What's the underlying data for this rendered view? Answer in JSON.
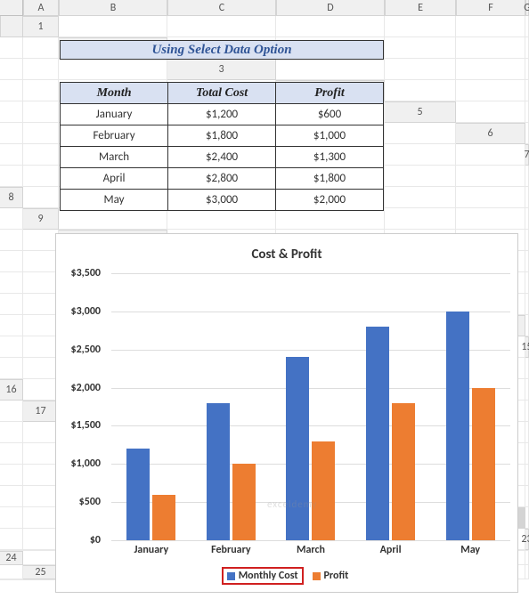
{
  "columns": [
    "A",
    "B",
    "C",
    "D",
    "E",
    "F",
    "G"
  ],
  "rowCount": 25,
  "activeRow": 22,
  "title": "Using Select Data Option",
  "table": {
    "headers": [
      "Month",
      "Total Cost",
      "Profit"
    ],
    "rows": [
      [
        "January",
        "$1,200",
        "$600"
      ],
      [
        "February",
        "$1,800",
        "$1,000"
      ],
      [
        "March",
        "$2,400",
        "$1,300"
      ],
      [
        "April",
        "$2,800",
        "$1,800"
      ],
      [
        "May",
        "$3,000",
        "$2,000"
      ]
    ]
  },
  "chart_data": {
    "type": "bar",
    "title": "Cost & Profit",
    "categories": [
      "January",
      "February",
      "March",
      "April",
      "May"
    ],
    "series": [
      {
        "name": "Monthly Cost",
        "values": [
          1200,
          1800,
          2400,
          2800,
          3000
        ],
        "color": "#4472c4",
        "highlighted": true
      },
      {
        "name": "Profit",
        "values": [
          600,
          1000,
          1300,
          1800,
          2000
        ],
        "color": "#ed7d31",
        "highlighted": false
      }
    ],
    "ylim": [
      0,
      3500
    ],
    "ystep": 500,
    "yticks": [
      "$0",
      "$500",
      "$1,000",
      "$1,500",
      "$2,000",
      "$2,500",
      "$3,000",
      "$3,500"
    ],
    "xlabel": "",
    "ylabel": "",
    "legend_position": "bottom"
  },
  "watermark": "exceldemy"
}
